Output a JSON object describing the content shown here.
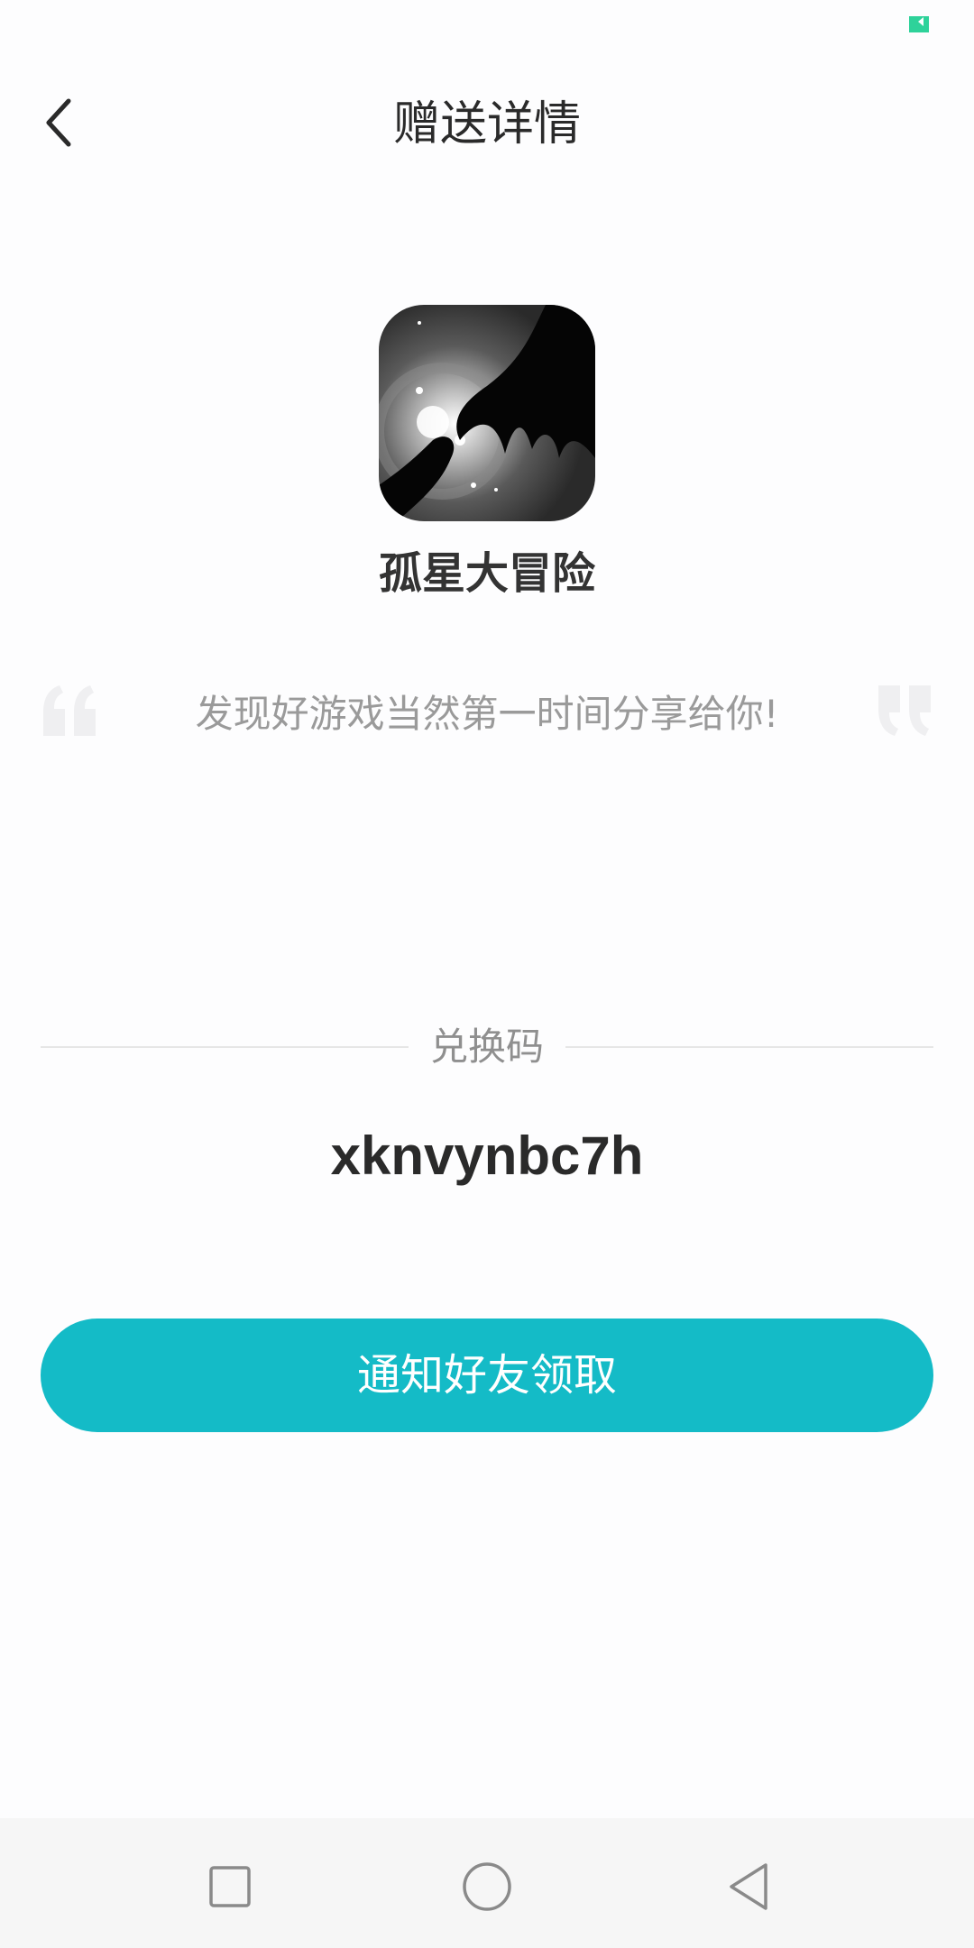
{
  "header": {
    "title": "赠送详情"
  },
  "app": {
    "name": "孤星大冒险"
  },
  "share": {
    "message": "发现好游戏当然第一时间分享给你!"
  },
  "redeem": {
    "label": "兑换码",
    "code": "xknvynbc7h"
  },
  "actions": {
    "notify_label": "通知好友领取"
  },
  "colors": {
    "accent": "#14bbc7",
    "battery": "#2ed29a"
  },
  "icons": {
    "back": "chevron-left-icon",
    "quote_open": "quote-open-icon",
    "quote_close": "quote-close-icon",
    "nav_recent": "square-icon",
    "nav_home": "circle-icon",
    "nav_back": "triangle-left-icon"
  }
}
